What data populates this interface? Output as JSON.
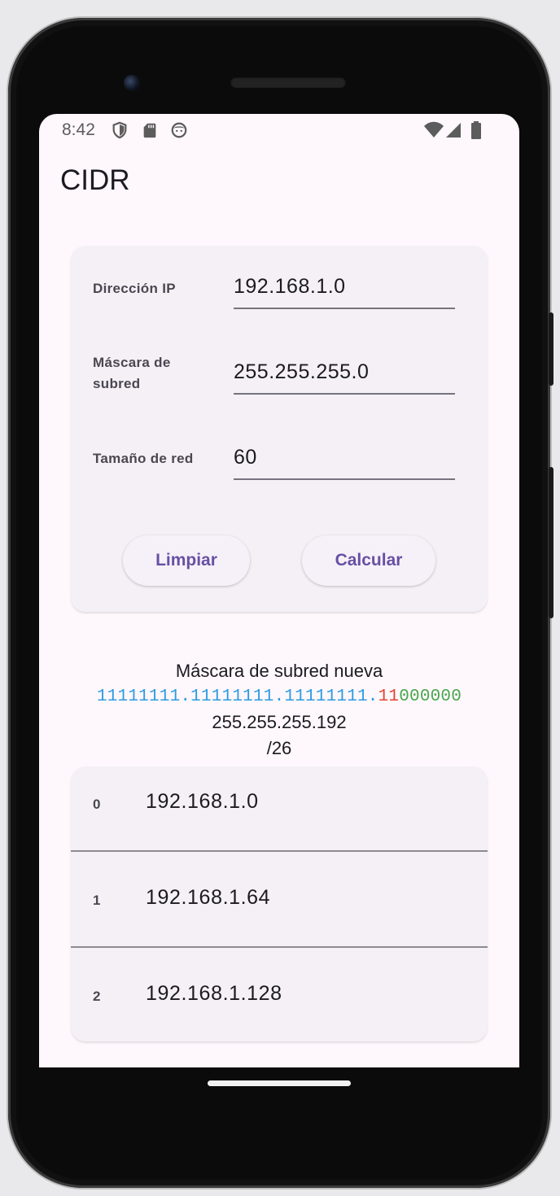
{
  "status_bar": {
    "time": "8:42",
    "left_icons": [
      "shield-icon",
      "sd-card-icon",
      "face-icon"
    ],
    "right_icons": [
      "wifi-icon",
      "signal-icon",
      "battery-icon"
    ]
  },
  "app_bar": {
    "title": "CIDR"
  },
  "form": {
    "ip": {
      "label": "Dirección IP",
      "value": "192.168.1.0"
    },
    "mask": {
      "label": "Máscara de subred",
      "value": "255.255.255.0"
    },
    "size": {
      "label": "Tamaño de red",
      "value": "60"
    },
    "clear_label": "Limpiar",
    "calc_label": "Calcular"
  },
  "result": {
    "heading": "Máscara de subred nueva",
    "binary": {
      "network": "11111111.11111111.11111111.",
      "subnet": "11",
      "host": "000000"
    },
    "decimal": "255.255.255.192",
    "prefix": "/26"
  },
  "subnets": [
    {
      "index": "0",
      "address": "192.168.1.0"
    },
    {
      "index": "1",
      "address": "192.168.1.64"
    },
    {
      "index": "2",
      "address": "192.168.1.128"
    }
  ],
  "colors": {
    "accent": "#6750a4",
    "binary_network": "#2d9be3",
    "binary_subnet": "#e44332",
    "binary_host": "#49a84d"
  }
}
